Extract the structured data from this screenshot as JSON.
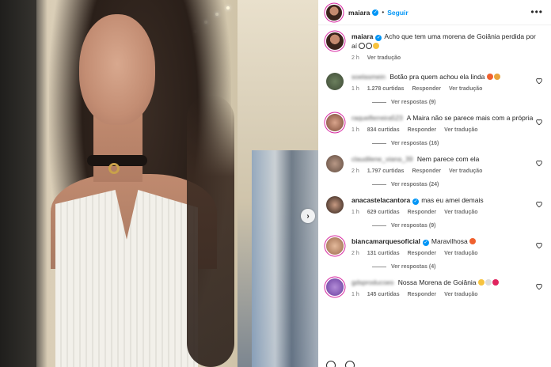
{
  "post": {
    "author": "maiara",
    "follow_label": "Seguir",
    "more_label": "•••"
  },
  "caption": {
    "user": "maiara",
    "text": "Acho que tem uma morena de Goiânia perdida por aí",
    "time": "2 h",
    "translate": "Ver tradução"
  },
  "comments": [
    {
      "user": "soelasmein",
      "user_blurred": true,
      "text": "Botão pra quem achou ela linda",
      "time": "1 h",
      "likes": "1.278 curtidas",
      "reply": "Responder",
      "translate": "Ver tradução",
      "replies": "Ver respostas (9)"
    },
    {
      "user": "raquelferreira523",
      "user_blurred": true,
      "text": "A Maira não se parece mais com a própria",
      "time": "1 h",
      "likes": "834 curtidas",
      "reply": "Responder",
      "translate": "Ver tradução",
      "replies": "Ver respostas (16)"
    },
    {
      "user": "claudilene_viana_39",
      "user_blurred": true,
      "text": "Nem parece com ela",
      "time": "2 h",
      "likes": "1.797 curtidas",
      "reply": "Responder",
      "translate": "Ver tradução",
      "replies": "Ver respostas (24)"
    },
    {
      "user": "anacastelacantora",
      "user_blurred": false,
      "text": "mas eu amei demais",
      "time": "1 h",
      "likes": "629 curtidas",
      "reply": "Responder",
      "translate": "Ver tradução",
      "replies": "Ver respostas (9)"
    },
    {
      "user": "biancamarquesoficial",
      "user_blurred": false,
      "text": "Maravilhosa",
      "time": "2 h",
      "likes": "131 curtidas",
      "reply": "Responder",
      "translate": "Ver tradução",
      "replies": "Ver respostas (4)"
    },
    {
      "user": "gdsproducoes",
      "user_blurred": true,
      "text": "Nossa Morena de Goiânia",
      "time": "1 h",
      "likes": "145 curtidas",
      "reply": "Responder",
      "translate": "Ver tradução",
      "replies": ""
    }
  ],
  "colors": {
    "accent": "#0095f6",
    "story_ring": "#d6249f",
    "meta_gray": "#737373"
  },
  "icons": {
    "verified": "verified-badge-icon",
    "heart": "heart-icon",
    "next": "chevron-right-icon"
  }
}
